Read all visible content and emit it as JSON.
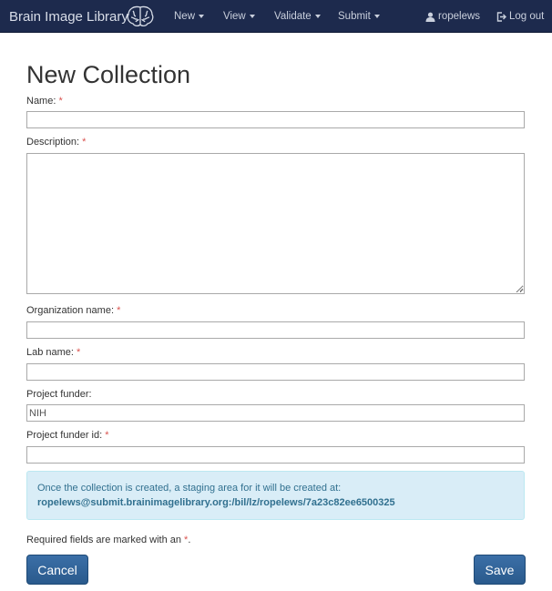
{
  "navbar": {
    "brand": "Brain Image Library",
    "logo_icon": "brain-icon",
    "menus": [
      {
        "label": "New"
      },
      {
        "label": "View"
      },
      {
        "label": "Validate"
      },
      {
        "label": "Submit"
      }
    ],
    "user": {
      "label": "ropelews",
      "icon": "user-icon"
    },
    "logout": {
      "label": "Log out",
      "icon": "logout-icon"
    }
  },
  "page": {
    "title": "New Collection"
  },
  "form": {
    "required_marker": "*",
    "name": {
      "label": "Name:",
      "value": ""
    },
    "description": {
      "label": "Description:",
      "value": ""
    },
    "organization_name": {
      "label": "Organization name:",
      "value": ""
    },
    "lab_name": {
      "label": "Lab name:",
      "value": ""
    },
    "project_funder": {
      "label": "Project funder:",
      "value": "NIH"
    },
    "project_funder_id": {
      "label": "Project funder id:",
      "value": ""
    }
  },
  "info": {
    "line1": "Once the collection is created, a staging area for it will be created at:",
    "path": "ropelews@submit.brainimagelibrary.org:/bil/lz/ropelews/7a23c82ee6500325"
  },
  "footnote": {
    "text": "Required fields are marked with an ",
    "marker": "*",
    "end": "."
  },
  "buttons": {
    "cancel": "Cancel",
    "save": "Save"
  },
  "colors": {
    "navbar_bg": "#1d2a4d",
    "button_bg": "#2f6198",
    "info_bg": "#d9edf7",
    "required": "#d9534f"
  }
}
